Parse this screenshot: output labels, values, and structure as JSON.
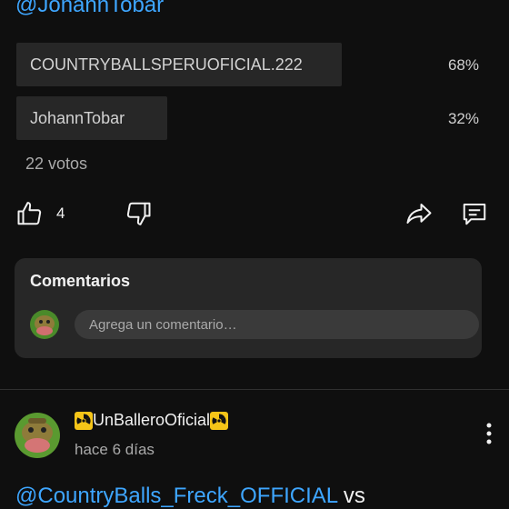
{
  "poll": {
    "title_mention": "@JohannTobar",
    "options": [
      {
        "label": "COUNTRYBALLSPERUOFICIAL.222",
        "percent": "68%",
        "fraction": 0.68
      },
      {
        "label": "JohannTobar",
        "percent": "32%",
        "fraction": 0.32
      }
    ],
    "votes": "22 votos"
  },
  "actions": {
    "like_icon": "thumb-up-icon",
    "like_count": "4",
    "dislike_icon": "thumb-down-icon",
    "share_icon": "share-icon",
    "comment_icon": "comment-icon"
  },
  "comments": {
    "title": "Comentarios",
    "input_placeholder": "Agrega un comentario…"
  },
  "next_post": {
    "author": "UnBalleroOficial",
    "author_badge_icon": "radioactive-icon",
    "time": "hace 6 días",
    "text_mention": "@CountryBalls_Freck_OFFICIAL",
    "text_rest": " vs"
  },
  "colors": {
    "background": "#0f0f0f",
    "card": "#272727",
    "mention": "#3ea6ff",
    "radioactive": "#f5c518"
  }
}
